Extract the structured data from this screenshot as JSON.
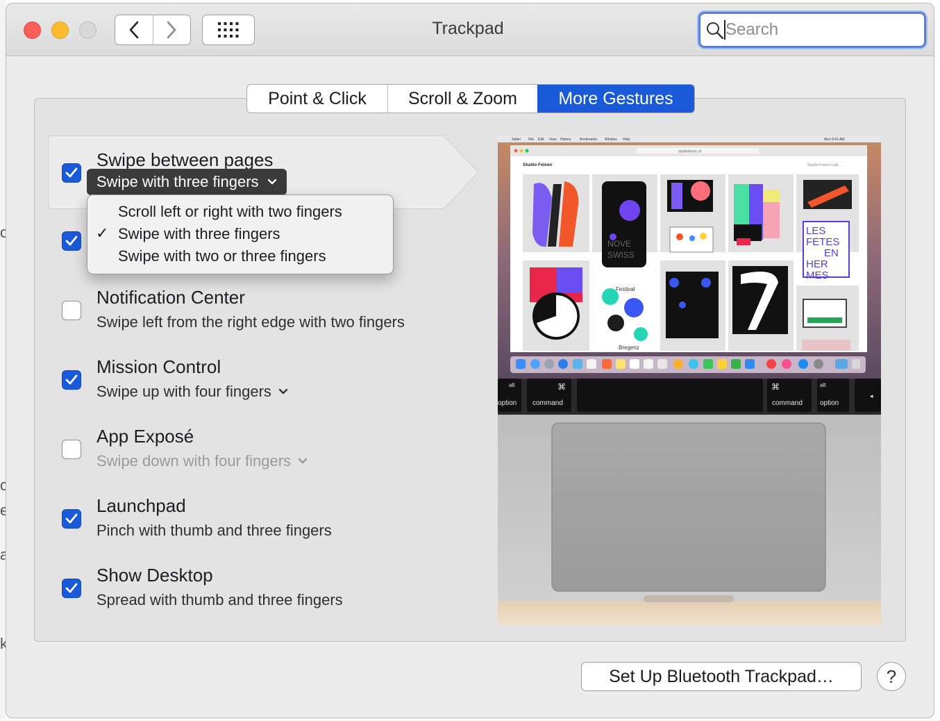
{
  "window": {
    "title": "Trackpad"
  },
  "search": {
    "placeholder": "Search"
  },
  "tabs": [
    {
      "label": "Point & Click",
      "selected": false
    },
    {
      "label": "Scroll & Zoom",
      "selected": false
    },
    {
      "label": "More Gestures",
      "selected": true
    }
  ],
  "gestures": [
    {
      "title": "Swipe between pages",
      "subtitle": "Swipe with three fingers",
      "checked": true,
      "has_menu": true
    },
    {
      "title": "",
      "subtitle": "",
      "checked": true,
      "has_menu": false
    },
    {
      "title": "Notification Center",
      "subtitle": "Swipe left from the right edge with two fingers",
      "checked": false,
      "has_menu": false
    },
    {
      "title": "Mission Control",
      "subtitle": "Swipe up with four fingers",
      "checked": true,
      "has_menu": true
    },
    {
      "title": "App Exposé",
      "subtitle": "Swipe down with four fingers",
      "checked": false,
      "has_menu": true,
      "disabled": true
    },
    {
      "title": "Launchpad",
      "subtitle": "Pinch with thumb and three fingers",
      "checked": true,
      "has_menu": false
    },
    {
      "title": "Show Desktop",
      "subtitle": "Spread with thumb and three fingers",
      "checked": true,
      "has_menu": false
    }
  ],
  "dropdown": {
    "options": [
      "Scroll left or right with two fingers",
      "Swipe with three fingers",
      "Swipe with two or three fingers"
    ],
    "selected_index": 1
  },
  "preview": {
    "menubar_items": [
      "Safari",
      "File",
      "Edit",
      "View",
      "History",
      "Bookmarks",
      "Window",
      "Help"
    ],
    "clock": "Mon 9:41 AM",
    "url": "studiofeixen.ch",
    "site_title": "Studio Feixen",
    "site_link": "Studio Feixen Lab. →",
    "keys": [
      "alt",
      "option",
      "⌘",
      "command",
      "⌘",
      "command",
      "alt",
      "option"
    ],
    "poster_text": [
      "NOVE",
      "SWISS",
      "LES",
      "FETES",
      "EN",
      "HER",
      "MES",
      "Festival",
      "Bregenz"
    ]
  },
  "buttons": {
    "setup": "Set Up Bluetooth Trackpad…",
    "help": "?"
  },
  "edge_glyphs": [
    "c",
    "c",
    "e",
    "a",
    "k"
  ],
  "colors": {
    "accent": "#1a5ad9",
    "close": "#fc5f57",
    "minimize": "#fdbc2e"
  }
}
